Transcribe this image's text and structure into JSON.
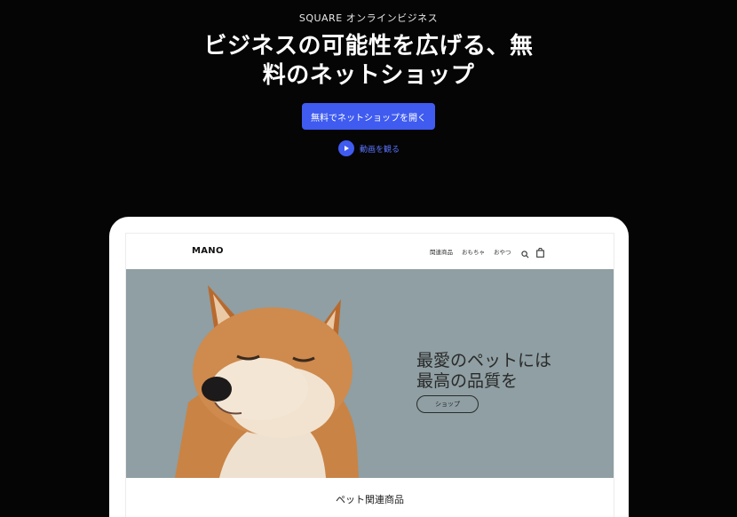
{
  "header": {
    "eyebrow": "SQUARE オンラインビジネス",
    "headline_line1": "ビジネスの可能性を広げる、無",
    "headline_line2": "料のネットショップ",
    "cta_label": "無料でネットショップを開く",
    "video_label": "動画を観る"
  },
  "shop": {
    "logo": "MANO",
    "nav": [
      "関連商品",
      "おもちゃ",
      "おやつ"
    ],
    "hero": {
      "title_line1": "最愛のペットには",
      "title_line2": "最高の品質を",
      "button_label": "ショップ"
    },
    "section_title": "ペット関連商品"
  },
  "colors": {
    "background": "#050505",
    "accent": "#3f5bf0",
    "hero_bg": "#8f9fa3"
  },
  "icons": [
    "play-icon",
    "search-icon",
    "shopping-bag-icon"
  ]
}
